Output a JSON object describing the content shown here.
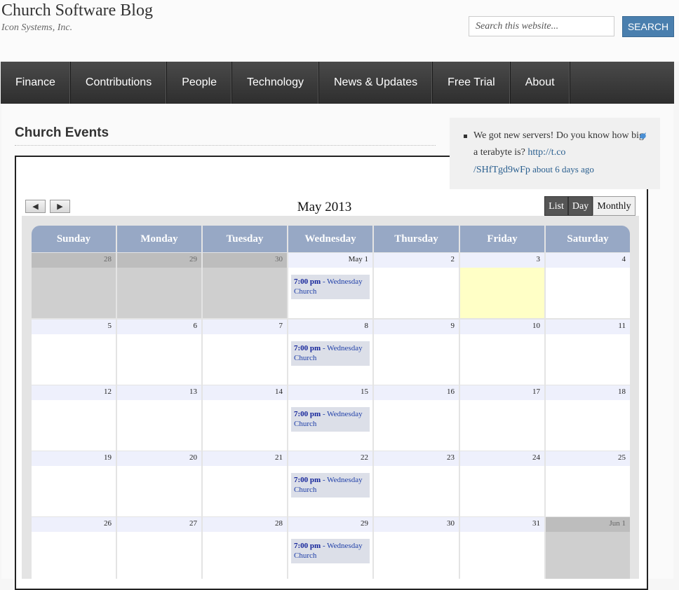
{
  "site": {
    "title": "Church Software Blog",
    "tagline": "Icon Systems, Inc."
  },
  "search": {
    "placeholder": "Search this website...",
    "button": "SEARCH"
  },
  "nav": [
    "Finance",
    "Contributions",
    "People",
    "Technology",
    "News & Updates",
    "Free Trial",
    "About"
  ],
  "page": {
    "title": "Church Events"
  },
  "tweet": {
    "text": "We got new servers! Do you know how big a terabyte is? ",
    "link": "http://t.co/SHfTgd9wFp",
    "link_line1": "http://t.co",
    "link_line2": "/SHfTgd9wFp",
    "time": " about 6 days ago"
  },
  "calendar": {
    "month": "May 2013",
    "prev": "◀",
    "next": "▶",
    "views": [
      "List",
      "Day",
      "Monthly"
    ],
    "active_view": "Monthly",
    "days": [
      "Sunday",
      "Monday",
      "Tuesday",
      "Wednesday",
      "Thursday",
      "Friday",
      "Saturday"
    ],
    "weeks": [
      [
        "28",
        "29",
        "30",
        "May 1",
        "2",
        "3",
        "4"
      ],
      [
        "5",
        "6",
        "7",
        "8",
        "9",
        "10",
        "11"
      ],
      [
        "12",
        "13",
        "14",
        "15",
        "16",
        "17",
        "18"
      ],
      [
        "19",
        "20",
        "21",
        "22",
        "23",
        "24",
        "25"
      ],
      [
        "26",
        "27",
        "28",
        "29",
        "30",
        "31",
        "Jun 1"
      ]
    ],
    "event": {
      "time": "7:00 pm",
      "title": " - Wednesday Church"
    }
  },
  "colors": {
    "header_bg": "#97a8c5",
    "today": "#ffffc6",
    "nav_bg": "#3a3a3a",
    "search_btn": "#4a7fae"
  }
}
